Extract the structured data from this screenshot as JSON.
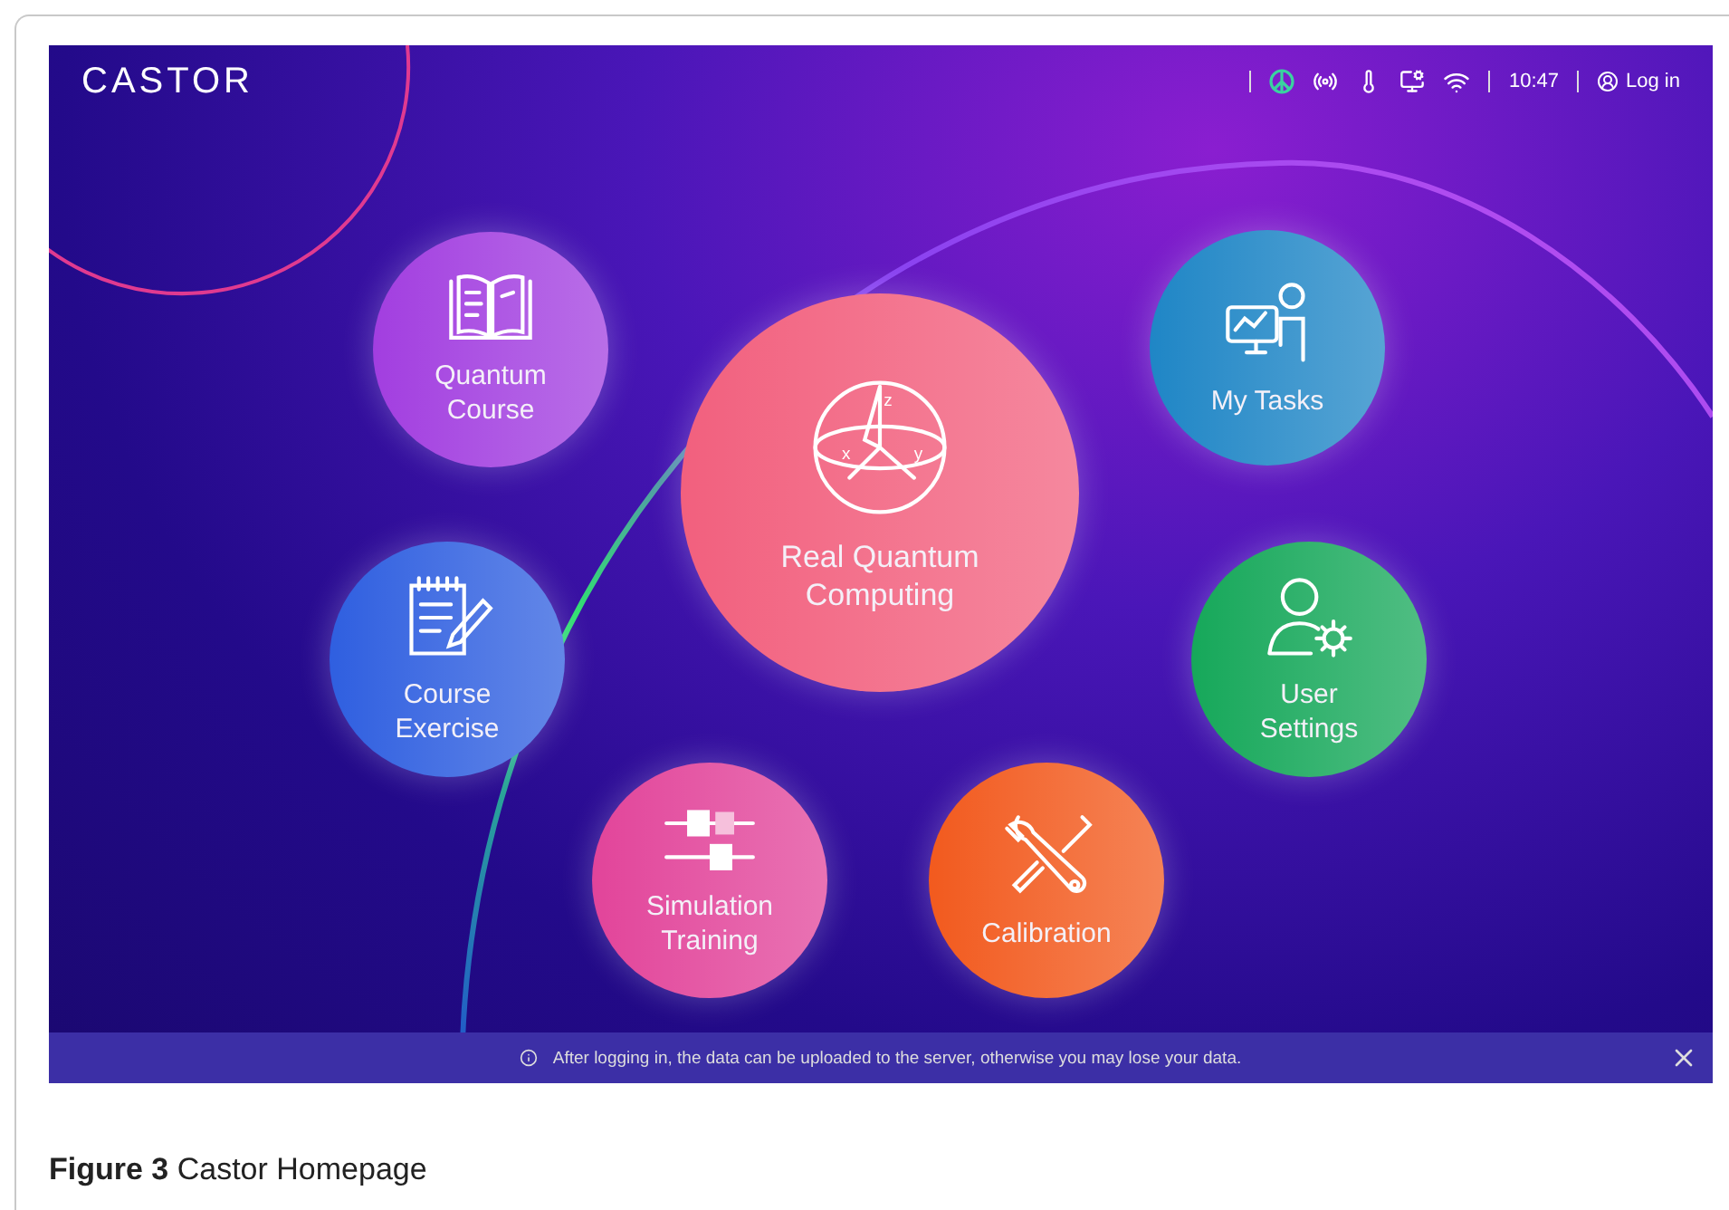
{
  "app": {
    "logo": "CASTOR",
    "status_bar": {
      "time": "10:47",
      "login": "Log in"
    }
  },
  "modules": [
    {
      "kind": "book",
      "label": "Quantum Course",
      "color": "#a23ee0"
    },
    {
      "kind": "notepad",
      "label": "Course Exercise",
      "color": "#2f5fe0"
    },
    {
      "kind": "sphere",
      "label": "Real Quantum Computing",
      "color": "#f2607e",
      "axes": [
        "z",
        "x",
        "y"
      ]
    },
    {
      "kind": "monitor",
      "label": "My Tasks",
      "color": "#1f86c6"
    },
    {
      "kind": "user-gear",
      "label": "User Settings",
      "color": "#16a85a"
    },
    {
      "kind": "sliders",
      "label": "Simulation Training",
      "color": "#e2449a"
    },
    {
      "kind": "tools",
      "label": "Calibration",
      "color": "#f25a1e"
    }
  ],
  "notice": {
    "text": "After logging in, the data can be uploaded to the server, otherwise you may lose your data."
  },
  "caption": "**Figure 3**  Castor Homepage"
}
